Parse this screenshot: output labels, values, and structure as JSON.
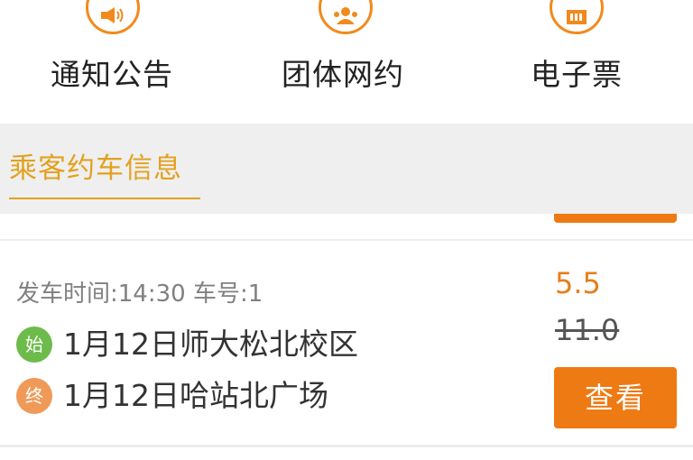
{
  "menu": {
    "items": [
      {
        "label": "通知公告",
        "icon": "speaker-icon"
      },
      {
        "label": "团体网约",
        "icon": "group-icon"
      },
      {
        "label": "电子票",
        "icon": "ticket-icon"
      }
    ]
  },
  "section": {
    "title": "乘客约车信息"
  },
  "trip": {
    "meta": "发车时间:14:30 车号:1",
    "start_badge": "始",
    "start_text": "1月12日师大松北校区",
    "end_badge": "终",
    "end_text": "1月12日哈站北广场",
    "price": "5.5",
    "original_price": "11.0",
    "view_label": "查看"
  },
  "colors": {
    "accent_orange": "#ee7a13",
    "section_gold": "#e3a11e",
    "start_green": "#6dbb4b",
    "end_orange": "#ef9a59"
  }
}
